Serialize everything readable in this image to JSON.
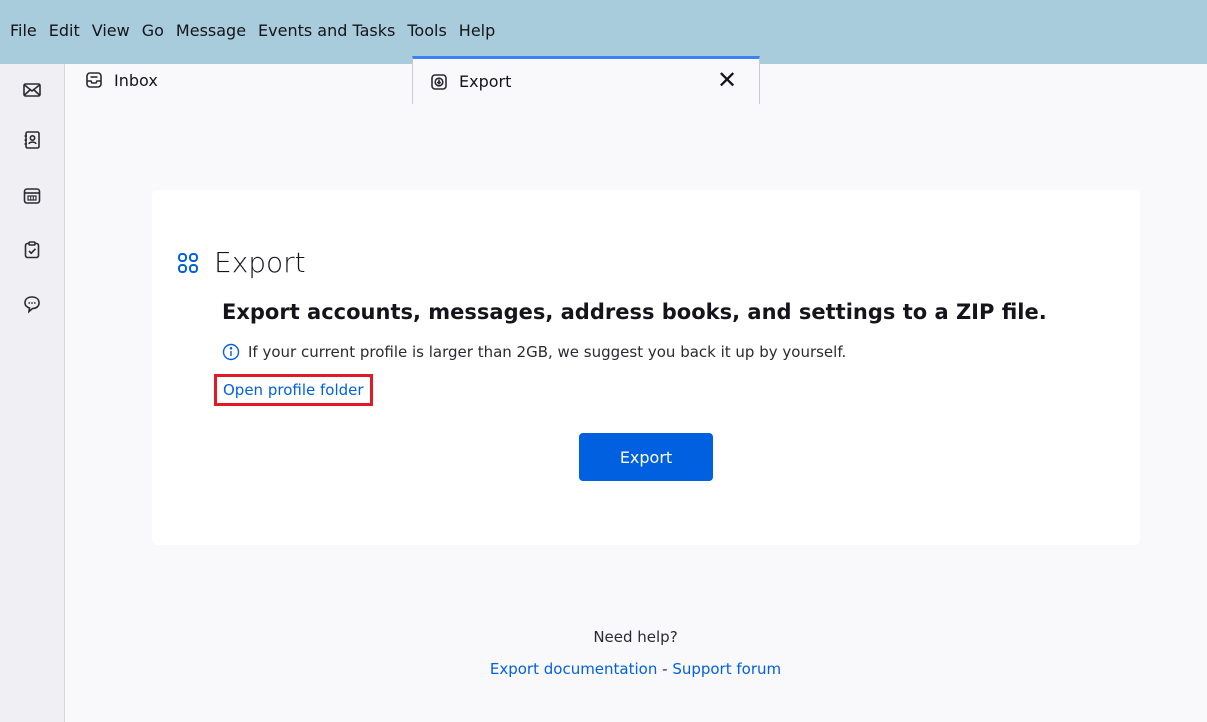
{
  "menubar": {
    "items": [
      {
        "label": "File"
      },
      {
        "label": "Edit"
      },
      {
        "label": "View"
      },
      {
        "label": "Go"
      },
      {
        "label": "Message"
      },
      {
        "label": "Events and Tasks"
      },
      {
        "label": "Tools"
      },
      {
        "label": "Help"
      }
    ]
  },
  "spaces": {
    "items": [
      {
        "icon": "mail-icon"
      },
      {
        "icon": "address-book-icon"
      },
      {
        "icon": "calendar-icon"
      },
      {
        "icon": "tasks-icon"
      },
      {
        "icon": "chat-icon"
      }
    ]
  },
  "tabs": {
    "inbox": {
      "label": "Inbox",
      "icon": "inbox-icon"
    },
    "export": {
      "label": "Export",
      "icon": "export-icon",
      "close": "✕"
    }
  },
  "card": {
    "title": "Export",
    "subtitle": "Export accounts, messages, address books, and settings to a ZIP file.",
    "info": "If your current profile is larger than 2GB, we suggest you back it up by yourself.",
    "profile_link": "Open profile folder",
    "export_button": "Export"
  },
  "footer": {
    "help": "Need help?",
    "doc_link": "Export documentation",
    "separator": " - ",
    "forum_link": "Support forum"
  },
  "colors": {
    "menubar_bg": "#a8ccdb",
    "accent": "#0060df",
    "highlight_box": "#e01b24",
    "tab_active_border": "#3b82f6"
  }
}
